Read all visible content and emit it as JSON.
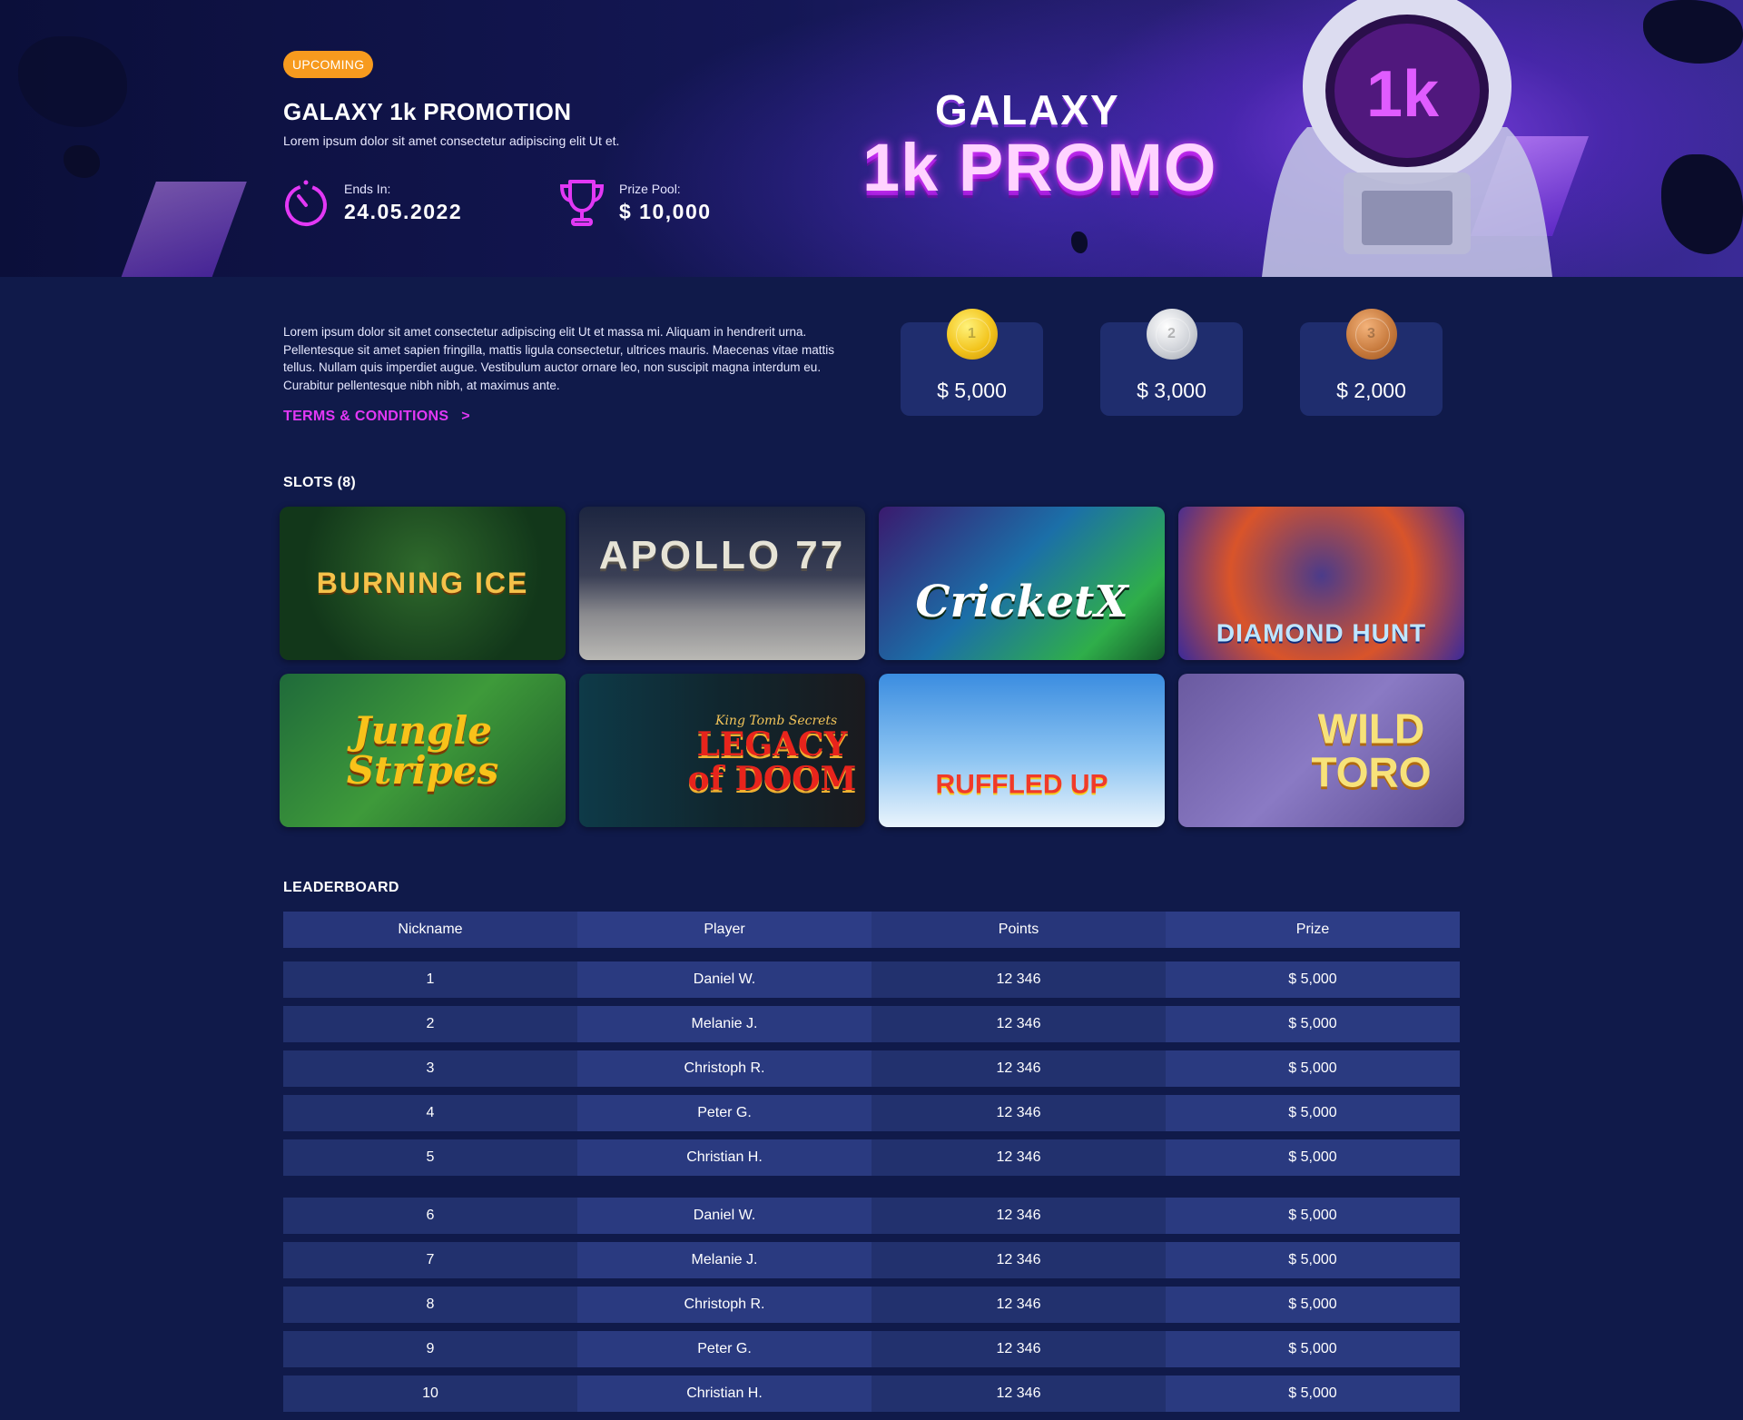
{
  "hero": {
    "badge": "UPCOMING",
    "title": "GALAXY 1k PROMOTION",
    "subtitle": "Lorem ipsum dolor sit amet consectetur adipiscing elit Ut et.",
    "ends_label": "Ends In:",
    "ends_value": "24.05.2022",
    "prize_label": "Prize Pool:",
    "prize_value": "$ 10,000",
    "art_line1": "GALAXY",
    "art_line2": "1k PROMO",
    "helmet_text": "1k",
    "colors": {
      "accent_pink": "#e238f5",
      "badge_orange": "#f79a1e"
    }
  },
  "info": {
    "description": "Lorem ipsum dolor sit amet consectetur adipiscing elit Ut et massa mi. Aliquam in hendrerit urna. Pellentesque sit amet sapien fringilla, mattis ligula consectetur, ultrices mauris. Maecenas vitae mattis tellus. Nullam quis imperdiet augue. Vestibulum auctor ornare leo, non suscipit magna interdum eu. Curabitur pellentesque nibh nibh, at maximus ante.",
    "terms_label": "TERMS & CONDITIONS",
    "terms_arrow": ">"
  },
  "prizes": [
    {
      "place": "1",
      "amount": "$ 5,000",
      "medal": "gold-medal-icon"
    },
    {
      "place": "2",
      "amount": "$ 3,000",
      "medal": "silver-medal-icon"
    },
    {
      "place": "3",
      "amount": "$ 2,000",
      "medal": "bronze-medal-icon"
    }
  ],
  "slots": {
    "title": "SLOTS (8)",
    "games": [
      {
        "name": "BURNING ICE"
      },
      {
        "name": "APOLLO 77"
      },
      {
        "name": "CricketX"
      },
      {
        "name": "DIAMOND HUNT"
      },
      {
        "name": "Jungle Stripes"
      },
      {
        "name": "LEGACY of DOOM",
        "tagline": "King Tomb Secrets"
      },
      {
        "name": "RUFFLED UP"
      },
      {
        "name": "WILD TORO"
      }
    ]
  },
  "leaderboard": {
    "title": "LEADERBOARD",
    "columns": [
      "Nickname",
      "Player",
      "Points",
      "Prize"
    ],
    "rows": [
      [
        "1",
        "Daniel W.",
        "12 346",
        "$ 5,000"
      ],
      [
        "2",
        "Melanie J.",
        "12 346",
        "$ 5,000"
      ],
      [
        "3",
        "Christoph R.",
        "12 346",
        "$ 5,000"
      ],
      [
        "4",
        "Peter G.",
        "12 346",
        "$ 5,000"
      ],
      [
        "5",
        "Christian H.",
        "12 346",
        "$ 5,000"
      ],
      [
        "6",
        "Daniel W.",
        "12 346",
        "$ 5,000"
      ],
      [
        "7",
        "Melanie J.",
        "12 346",
        "$ 5,000"
      ],
      [
        "8",
        "Christoph R.",
        "12 346",
        "$ 5,000"
      ],
      [
        "9",
        "Peter G.",
        "12 346",
        "$ 5,000"
      ],
      [
        "10",
        "Christian H.",
        "12 346",
        "$ 5,000"
      ]
    ]
  }
}
